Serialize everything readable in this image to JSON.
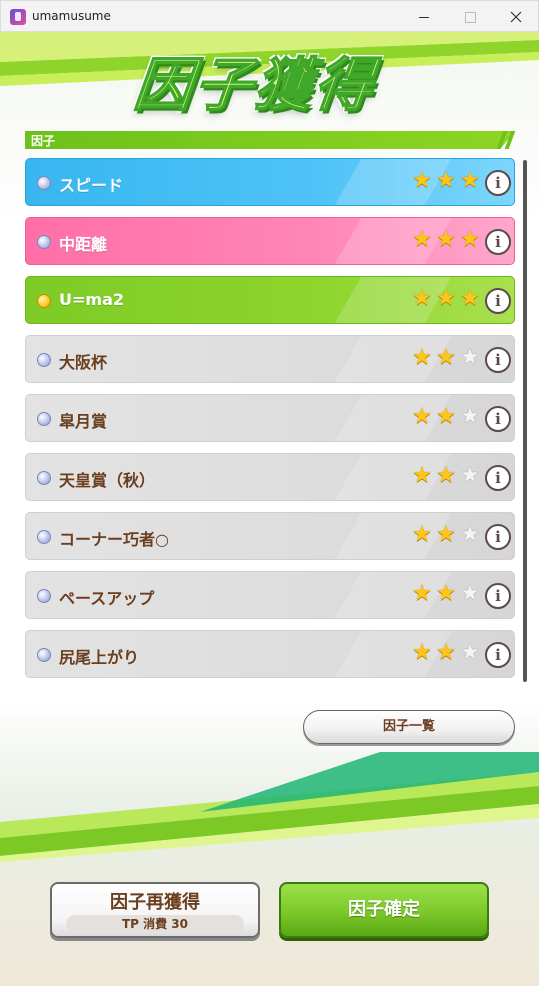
{
  "window": {
    "title": "umamusume"
  },
  "header": {
    "title": "因子獲得"
  },
  "section": {
    "label": "因子"
  },
  "factors": [
    {
      "name": "スピード",
      "color": "#4fc3f7",
      "style": "blue",
      "dot": "silver",
      "stars": 3,
      "max_stars": 3
    },
    {
      "name": "中距離",
      "color": "#ff86b7",
      "style": "pink",
      "dot": "silver",
      "stars": 3,
      "max_stars": 3
    },
    {
      "name": "U=ma2",
      "color": "#8ed52d",
      "style": "green",
      "dot": "gold",
      "stars": 3,
      "max_stars": 3
    },
    {
      "name": "大阪杯",
      "color": "#dedede",
      "style": "gray",
      "dot": "silver",
      "stars": 2,
      "max_stars": 3
    },
    {
      "name": "皐月賞",
      "color": "#dedede",
      "style": "gray",
      "dot": "silver",
      "stars": 2,
      "max_stars": 3
    },
    {
      "name": "天皇賞（秋）",
      "color": "#dedede",
      "style": "gray",
      "dot": "silver",
      "stars": 2,
      "max_stars": 3
    },
    {
      "name": "コーナー巧者○",
      "color": "#dedede",
      "style": "gray",
      "dot": "silver",
      "stars": 2,
      "max_stars": 3
    },
    {
      "name": "ペースアップ",
      "color": "#dedede",
      "style": "gray",
      "dot": "silver",
      "stars": 2,
      "max_stars": 3
    },
    {
      "name": "尻尾上がり",
      "color": "#dedede",
      "style": "gray",
      "dot": "silver",
      "stars": 2,
      "max_stars": 3
    }
  ],
  "buttons": {
    "factor_list": "因子一覧",
    "reacquire": "因子再獲得",
    "reacquire_cost": "TP 消費 30",
    "confirm": "因子確定"
  },
  "icons": {
    "info": "i",
    "star": "★"
  }
}
